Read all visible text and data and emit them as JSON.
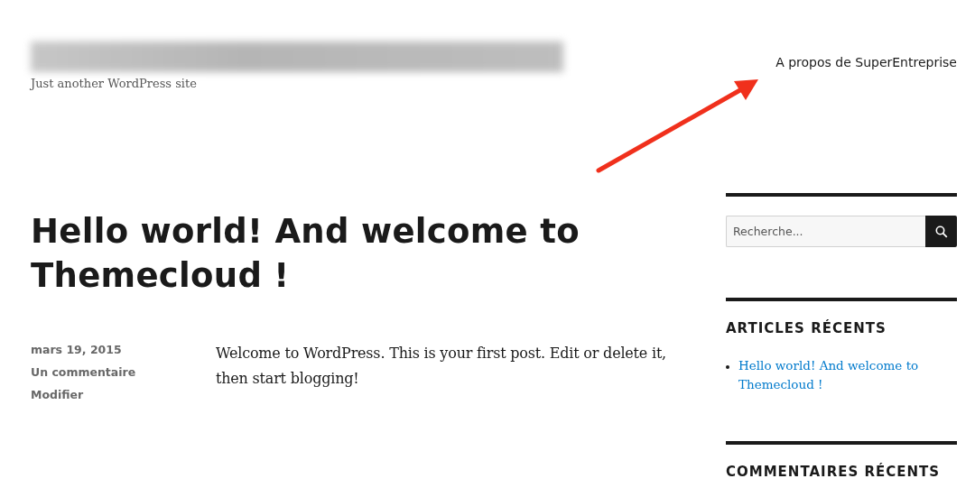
{
  "header": {
    "tagline": "Just another WordPress site",
    "menu": [
      "A propos de SuperEntreprise"
    ]
  },
  "post": {
    "title": "Hello world! And welcome to Themecloud !",
    "date": "mars 19, 2015",
    "comments_link": "Un commentaire",
    "edit_link": "Modifier",
    "body": "Welcome to WordPress. This is your first post. Edit or delete it, then start blogging!"
  },
  "sidebar": {
    "search": {
      "placeholder": "Recherche..."
    },
    "widgets": [
      {
        "heading": "ARTICLES RÉCENTS",
        "links": [
          "Hello world! And welcome to Themecloud !"
        ]
      },
      {
        "heading": "COMMENTAIRES RÉCENTS"
      }
    ]
  }
}
